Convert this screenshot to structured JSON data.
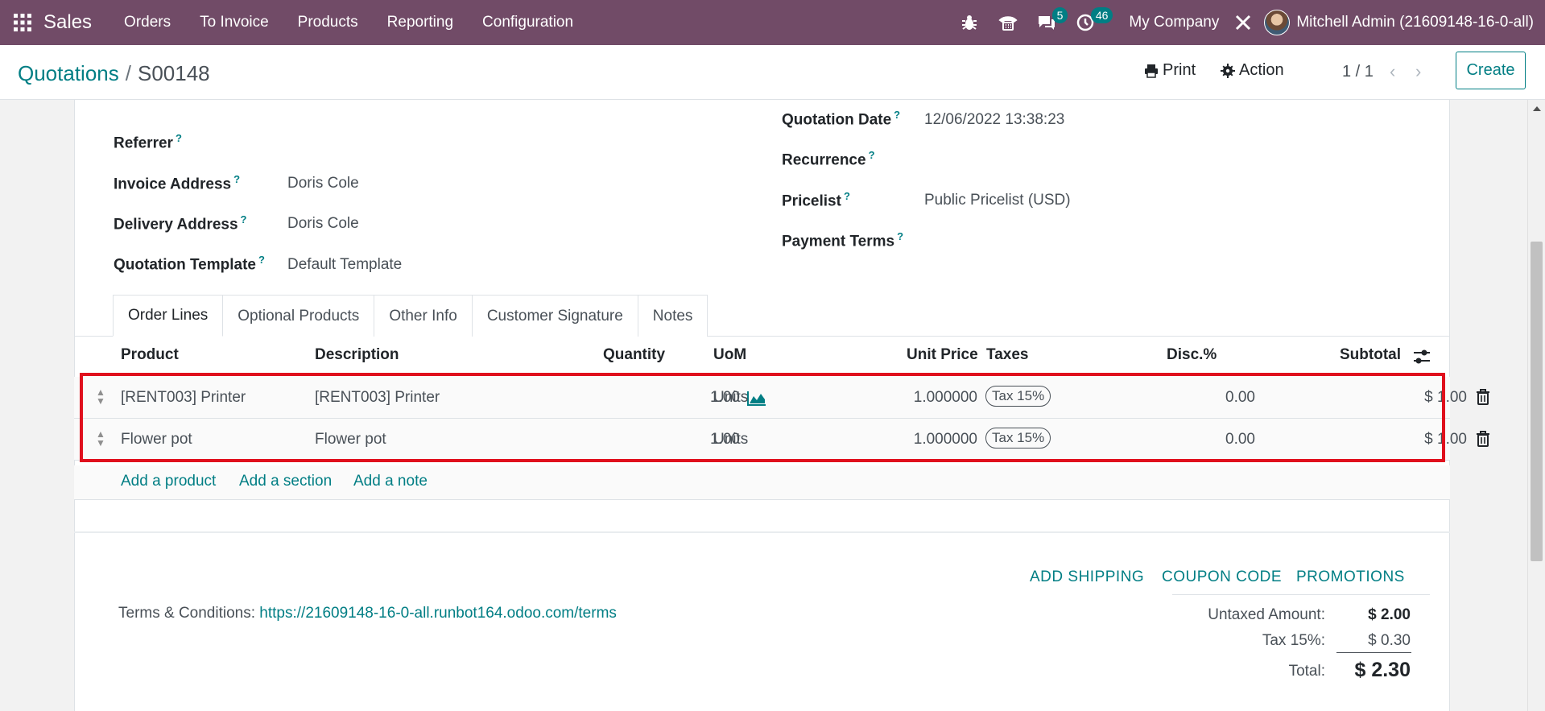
{
  "nav": {
    "app_name": "Sales",
    "menu": [
      "Orders",
      "To Invoice",
      "Products",
      "Reporting",
      "Configuration"
    ],
    "messages_count": "5",
    "activities_count": "46",
    "company": "My Company",
    "user": "Mitchell Admin (21609148-16-0-all)"
  },
  "control_panel": {
    "breadcrumb_parent": "Quotations",
    "breadcrumb_sep": "/",
    "breadcrumb_current": "S00148",
    "print_label": "Print",
    "action_label": "Action",
    "pager": "1 / 1",
    "create_label": "Create"
  },
  "form": {
    "referrer_label": "Referrer",
    "invoice_address_label": "Invoice Address",
    "invoice_address": "Doris Cole",
    "delivery_address_label": "Delivery Address",
    "delivery_address": "Doris Cole",
    "template_label": "Quotation Template",
    "template": "Default Template",
    "quotation_date_label": "Quotation Date",
    "quotation_date": "12/06/2022 13:38:23",
    "recurrence_label": "Recurrence",
    "pricelist_label": "Pricelist",
    "pricelist": "Public Pricelist (USD)",
    "payment_terms_label": "Payment Terms",
    "help_mark": "?"
  },
  "tabs": [
    "Order Lines",
    "Optional Products",
    "Other Info",
    "Customer Signature",
    "Notes"
  ],
  "table": {
    "headers": {
      "product": "Product",
      "description": "Description",
      "quantity": "Quantity",
      "uom": "UoM",
      "unit_price": "Unit Price",
      "taxes": "Taxes",
      "discount": "Disc.%",
      "subtotal": "Subtotal"
    },
    "rows": [
      {
        "product": "[RENT003] Printer",
        "description": "[RENT003] Printer",
        "quantity": "1.00",
        "uom": "Units",
        "unit_price": "1.000000",
        "tax": "Tax 15%",
        "discount": "0.00",
        "subtotal": "$ 1.00"
      },
      {
        "product": "Flower pot",
        "description": "Flower pot",
        "quantity": "1.00",
        "uom": "Units",
        "unit_price": "1.000000",
        "tax": "Tax 15%",
        "discount": "0.00",
        "subtotal": "$ 1.00"
      }
    ],
    "add_product": "Add a product",
    "add_section": "Add a section",
    "add_note": "Add a note"
  },
  "footer": {
    "add_shipping": "ADD SHIPPING",
    "coupon_code": "COUPON CODE",
    "promotions": "PROMOTIONS",
    "terms_label": "Terms & Conditions:",
    "terms_url": "https://21609148-16-0-all.runbot164.odoo.com/terms",
    "untaxed_label": "Untaxed Amount:",
    "untaxed_value": "$ 2.00",
    "tax_label": "Tax 15%:",
    "tax_value": "$ 0.30",
    "total_label": "Total:",
    "total_value": "$ 2.30"
  },
  "colors": {
    "nav_bg": "#714b67",
    "accent": "#017e84",
    "highlight_box": "#e0101d"
  }
}
